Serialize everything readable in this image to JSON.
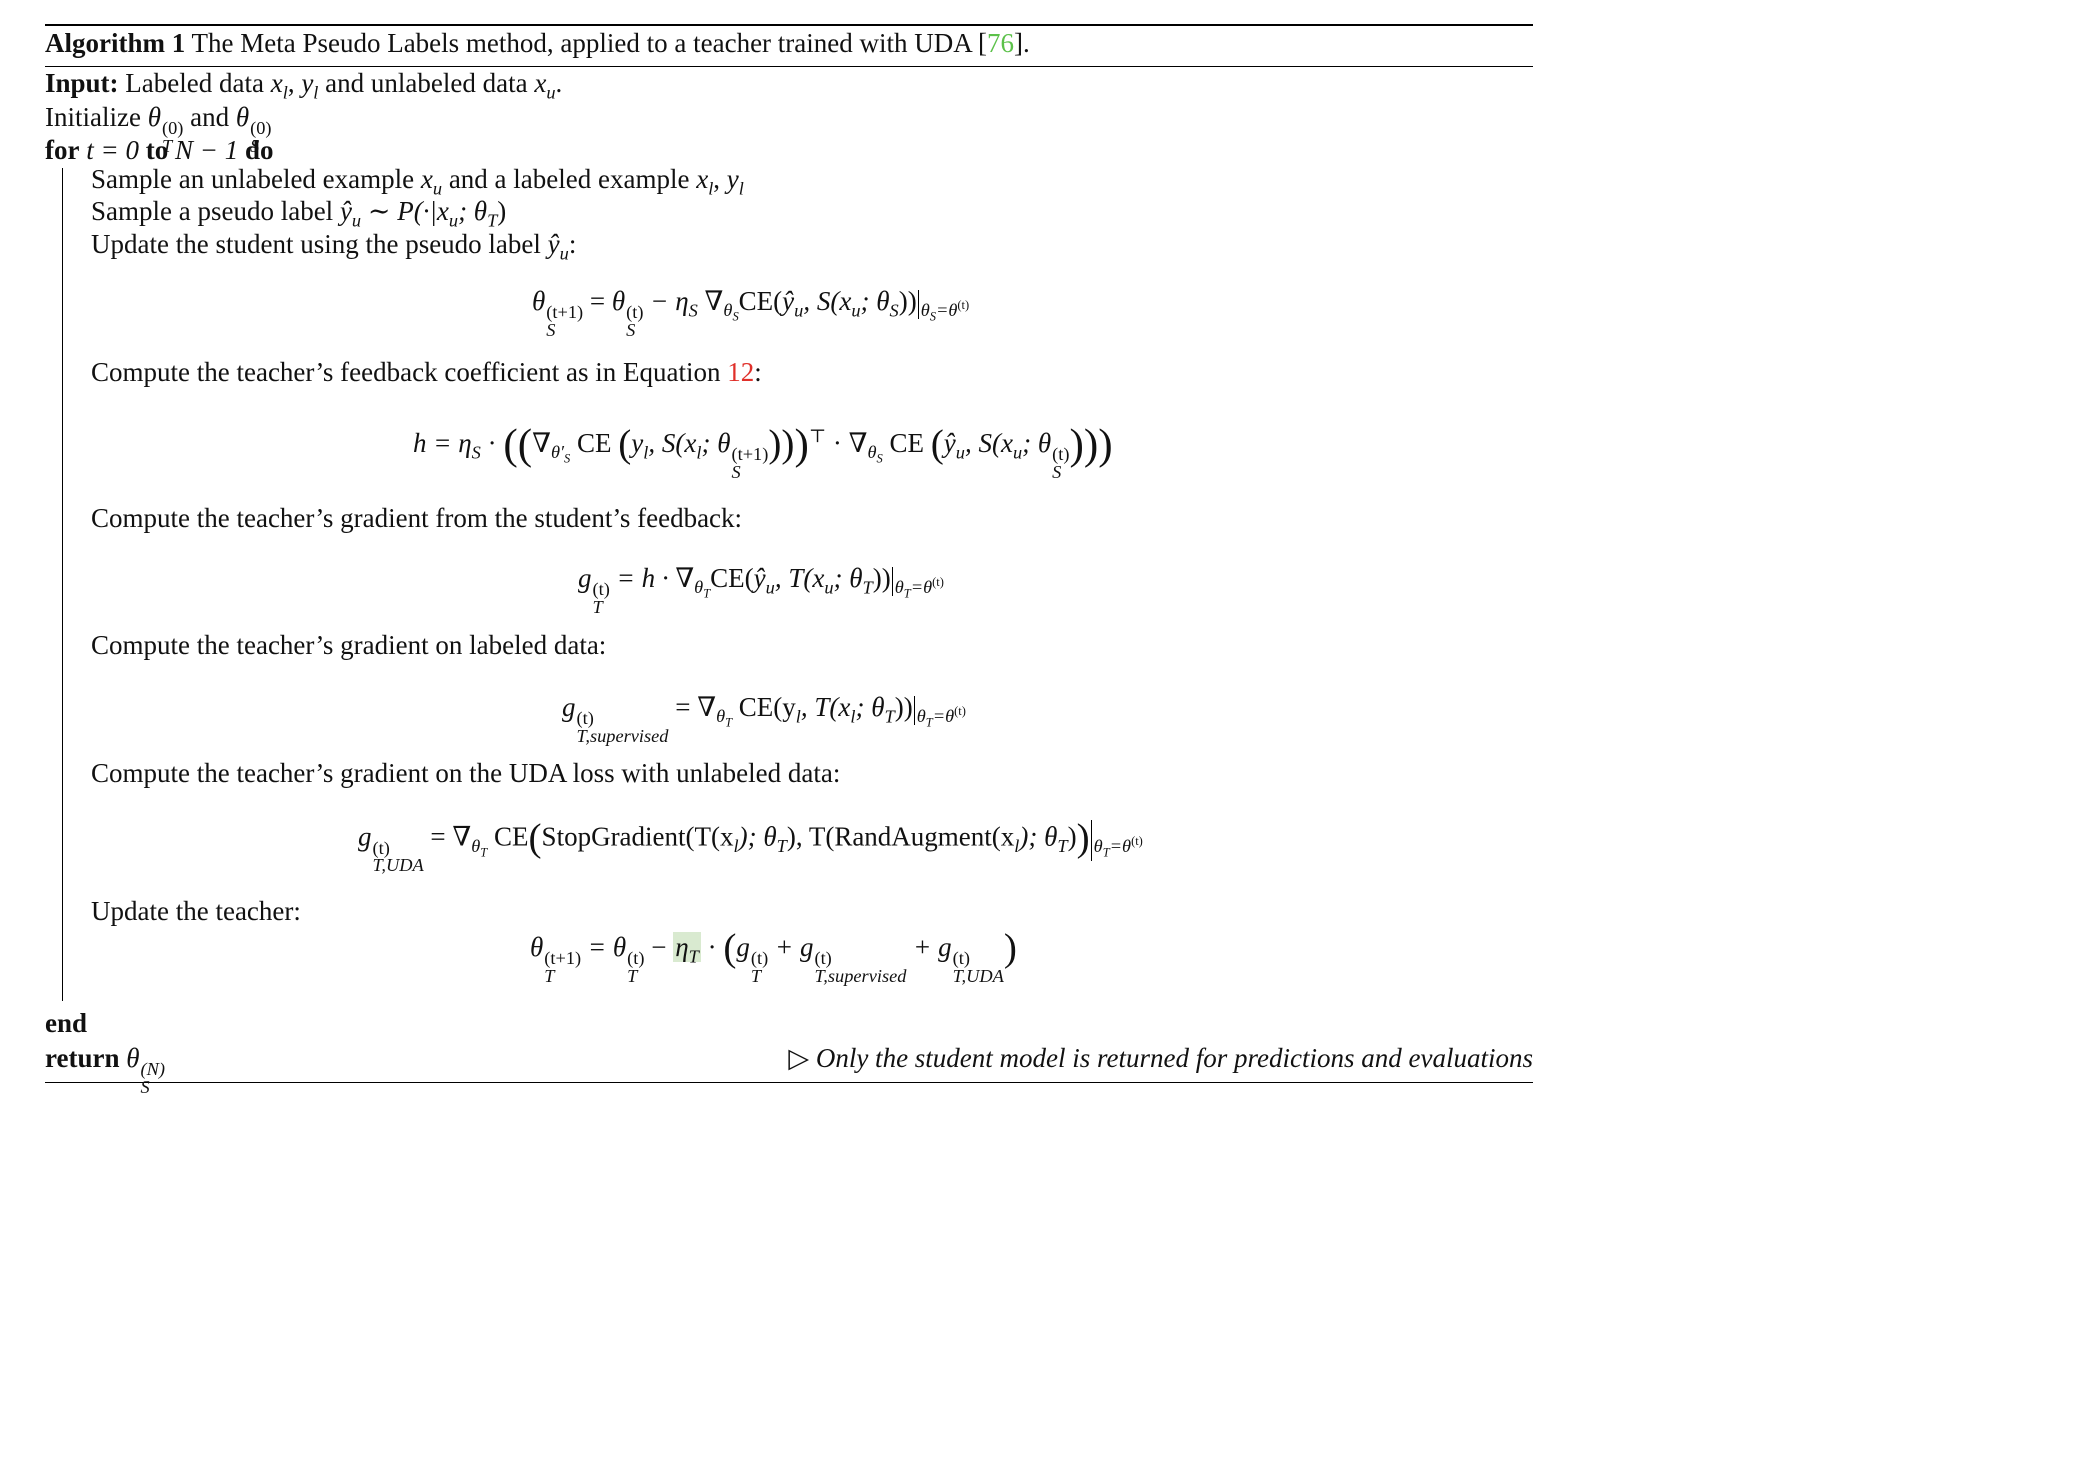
{
  "algorithm": {
    "label": "Algorithm 1",
    "title": "The Meta Pseudo Labels method, applied to a teacher trained with UDA [",
    "citation": "76",
    "title_end": "]."
  },
  "input": {
    "keyword": "Input:",
    "text1": " Labeled data ",
    "xl": "x",
    "l": "l",
    "comma": ", ",
    "yl": "y",
    "text2": " and unlabeled data ",
    "xu": "x",
    "u": "u",
    "period": "."
  },
  "init": {
    "text": "Initialize ",
    "theta": "θ",
    "sup": "(0)",
    "subT": "T",
    "and": " and ",
    "subS": "S"
  },
  "loop": {
    "for": "for",
    "t_eq": " t = 0 ",
    "to": "to",
    "n_minus": " N − 1 ",
    "do": "do",
    "end": "end"
  },
  "steps": {
    "sample1": "Sample an unlabeled example ",
    "sample1_and": " and a labeled example ",
    "sample2": "Sample a pseudo label ",
    "sample2_dist": " ∼ P(·|x",
    "sample2_rest": "; θ",
    "sample2_close": ")",
    "update_student": "Update the student using the pseudo label ",
    "colon": ":",
    "feedback_coef": "Compute the teacher’s feedback coefficient as in Equation ",
    "eq_ref": "12",
    "teacher_grad_feedback": "Compute the teacher’s gradient from the student’s feedback:",
    "teacher_grad_labeled": "Compute the teacher’s gradient on labeled data:",
    "teacher_grad_uda": "Compute the teacher’s gradient on the UDA loss with unlabeled data:",
    "update_teacher": "Update the teacher:"
  },
  "equations": {
    "student_update": {
      "lhs": "θ",
      "lhs_sup": "(t+1)",
      "lhs_sub": "S",
      "eq": " = ",
      "rhs_theta": "θ",
      "rhs_sup": "(t)",
      "rhs_sub": "S",
      "minus": " − η",
      "eta_sub": "S",
      "nabla": " ∇",
      "nabla_sub": "θ",
      "nabla_subsub": "S",
      "ce": "CE(",
      "yhat": "ŷ",
      "u": "u",
      "mid": ", S(x",
      "mid2": "; θ",
      "close": "))",
      "eval_sub": "θ",
      "eval_sub2": "S",
      "eval_eq": "=θ",
      "eval_sup": "(t)"
    },
    "feedback": {
      "h": "h = η",
      "eta_sub": "S",
      "dot": " · ",
      "open": "((",
      "nabla": "∇",
      "nabla_sub": "θ′",
      "nabla_subsub": "S",
      "ce": " CE ",
      "paren_open": "(",
      "args": "y",
      "args_sub": "l",
      "args2": ", S(x",
      "args2_sub": "l",
      "args3": "; θ",
      "sup": "(t+1)",
      "sub": "S",
      "args_close": "))",
      "close": ")",
      "transpose": "⊤",
      "dot2": " · ∇",
      "n2_sub": "θ",
      "n2_subsub": "S",
      "ce2": " CE ",
      "p2": "(",
      "yhat": "ŷ",
      "u": "u",
      "args4": ", S(x",
      "args4_sub": "u",
      "args5": "; θ",
      "sup2": "(t)",
      "sub2": "S",
      "end": ")))"
    },
    "teacher_feedback_grad": {
      "g": "g",
      "sup": "(t)",
      "sub": "T",
      "eq": " = h · ∇",
      "n_sub": "θ",
      "n_subsub": "T",
      "ce": "CE(",
      "yhat": "ŷ",
      "u": "u",
      "mid": ", T(x",
      "mid2": "; θ",
      "close": "))",
      "eval_sub": "θ",
      "eval_sub2": "T",
      "eval_eq": "=θ",
      "eval_sup": "(t)"
    },
    "teacher_supervised_grad": {
      "g": "g",
      "sup": "(t)",
      "sub": "T,supervised",
      "eq": " = ∇",
      "n_sub": "θ",
      "n_subsub": "T",
      "ce": "  CE(y",
      "l": "l",
      "mid": ", T(x",
      "mid2": "; θ",
      "close": "))",
      "eval_sub": "θ",
      "eval_sub2": "T",
      "eval_eq": "=θ",
      "eval_sup": "(t)"
    },
    "teacher_uda_grad": {
      "g": "g",
      "sup": "(t)",
      "sub": "T,UDA",
      "eq": " = ∇",
      "n_sub": "θ",
      "n_subsub": "T",
      "ce": "  CE",
      "open": "(",
      "stop": "StopGradient(T(x",
      "l": "l",
      "mid": "); θ",
      "mid_close": "), T(RandAugment(x",
      "mid3": "); θ",
      "close": ")",
      "bigclose": ")",
      "eval_sub": "θ",
      "eval_sub2": "T",
      "eval_eq": "=θ",
      "eval_sup": "(t)"
    },
    "teacher_update": {
      "lhs": "θ",
      "lhs_sup": "(t+1)",
      "lhs_sub": "T",
      "eq": " = θ",
      "rhs_sup": "(t)",
      "rhs_sub": "T",
      "minus": " − ",
      "eta": "η",
      "eta_sub": "T",
      "dot": " · ",
      "open": "(",
      "g1": "g",
      "plus": " + g",
      "plus2": " + g",
      "s1": "T",
      "s2": "T,supervised",
      "s3": "T,UDA",
      "close": ")"
    }
  },
  "return": {
    "keyword": "return",
    "theta": " θ",
    "sup": "(N)",
    "sub": "S",
    "comment_marker": "▷",
    "comment": " Only the student model is returned for predictions and evaluations"
  },
  "colors": {
    "citation": "#5cc14a",
    "equation_ref": "#e0302a",
    "highlight": "#d9ead0"
  }
}
